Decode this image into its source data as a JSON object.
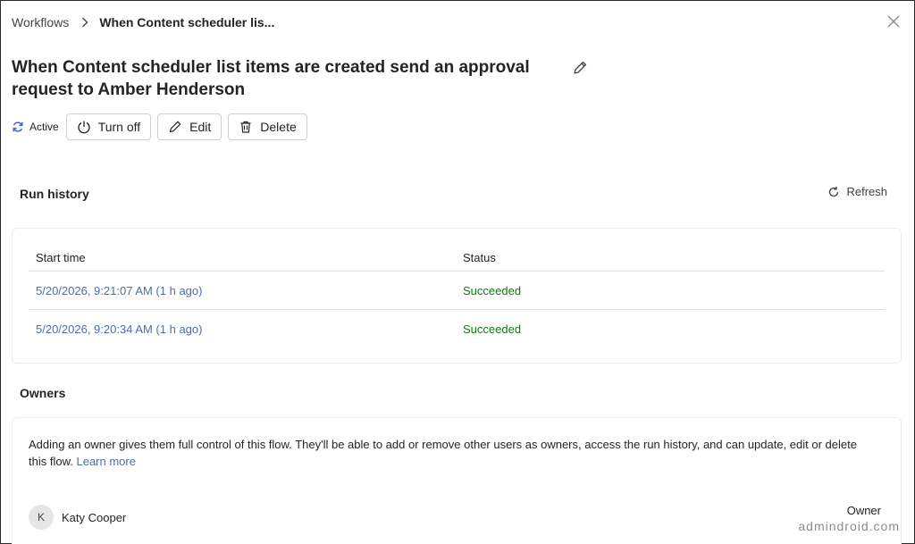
{
  "breadcrumb": {
    "root": "Workflows",
    "current": "When Content scheduler lis..."
  },
  "flow": {
    "title": "When Content scheduler list items are created send an approval request to Amber Henderson",
    "status": "Active"
  },
  "toolbar": {
    "turn_off_label": "Turn off",
    "edit_label": "Edit",
    "delete_label": "Delete"
  },
  "run_history": {
    "title": "Run history",
    "refresh_label": "Refresh",
    "columns": [
      "Start time",
      "Status"
    ],
    "rows": [
      {
        "start_time": "5/20/2026, 9:21:07 AM (1 h ago)",
        "status": "Succeeded"
      },
      {
        "start_time": "5/20/2026, 9:20:34 AM (1 h ago)",
        "status": "Succeeded"
      }
    ]
  },
  "owners": {
    "title": "Owners",
    "description": "Adding an owner gives them full control of this flow. They'll be able to add or remove other users as owners, access the run history, and can update, edit or delete this flow.",
    "learn_more": "Learn more",
    "list": [
      {
        "initial": "K",
        "name": "Katy Cooper",
        "role": "Owner"
      }
    ]
  },
  "watermark": "admindroid.com",
  "colors": {
    "link": "#4f6bb0",
    "success": "#107c10",
    "accent": "#4f6bd8"
  },
  "icons": [
    "chevron-right-icon",
    "close-icon",
    "pencil-icon",
    "sync-icon",
    "power-icon",
    "trash-icon",
    "refresh-icon"
  ]
}
